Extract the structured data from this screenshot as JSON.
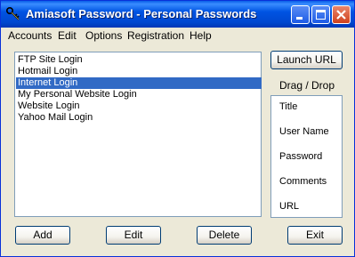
{
  "window": {
    "title": "Amiasoft Password - Personal Passwords"
  },
  "menu": [
    "Accounts",
    "Edit",
    "Options",
    "Registration",
    "Help"
  ],
  "list": {
    "items": [
      "FTP Site Login",
      "Hotmail Login",
      "Internet Login",
      "My Personal Website Login",
      "Website Login",
      "Yahoo Mail Login"
    ],
    "selected_index": 2
  },
  "buttons": {
    "launch_url": "Launch URL",
    "add": "Add",
    "edit": "Edit",
    "delete": "Delete",
    "exit": "Exit"
  },
  "dragdrop": {
    "label": "Drag / Drop",
    "fields": [
      "Title",
      "User Name",
      "Password",
      "Comments",
      "URL"
    ]
  },
  "colors": {
    "titlebar": "#0054e3",
    "selection": "#316ac5",
    "close_button": "#d0411e"
  },
  "icons": {
    "app": "key-icon",
    "minimize": "minimize-icon",
    "maximize": "maximize-icon",
    "close": "close-icon"
  }
}
